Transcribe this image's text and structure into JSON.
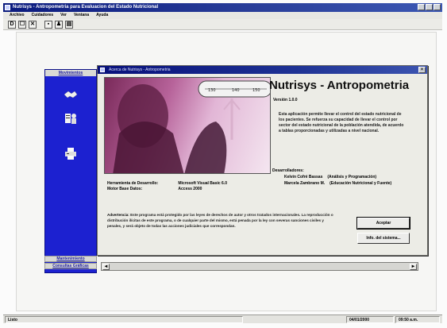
{
  "window": {
    "title": "Nutrisys - Antropometria para Evaluacion del Estado Nutricional"
  },
  "menu": [
    "Archivo",
    "Cuidadores",
    "Ver",
    "Ventana",
    "Ayuda"
  ],
  "toolbar": {
    "buttons": [
      {
        "icon": "new-document-icon",
        "glyph": "D"
      },
      {
        "icon": "open-icon",
        "glyph": "☐"
      },
      {
        "icon": "close-icon",
        "glyph": "✕"
      },
      {
        "icon": "save-icon",
        "glyph": "▪"
      },
      {
        "icon": "find-icon",
        "glyph": "♟"
      },
      {
        "icon": "exit-icon",
        "glyph": "▤"
      }
    ]
  },
  "sidebar": {
    "header": "Movimientos",
    "footer_items": [
      "Mantenimiento",
      "Consultas Gráficas"
    ]
  },
  "dialog": {
    "title": "Acerca de Nutrisys - Antropometria",
    "app_name": "Nutrisys - Antropometria",
    "version": "Versión 1.0.0",
    "description": "Esta aplicación permite llevar el control del estado nutricional de los pacientes. Se refuerza su capacidad de llevar el control por sector del estado nutricional de la población atendida, de acuerdo a tablas proporcionadas y utilizadas a nivel nacional.",
    "developers_label": "Desarrolladores:",
    "developers": [
      {
        "name": "Kelvin Cofré Bassas",
        "role": "(Análisis y Programación)"
      },
      {
        "name": "Marcela Zambrano M.",
        "role": "(Educación Nutricional y Fuente)"
      }
    ],
    "info": [
      {
        "label": "Herramienta de Desarrollo:",
        "value": "Microsoft Visual Basic 6.0"
      },
      {
        "label": "Motor Base Datos:",
        "value": "Access 2000"
      }
    ],
    "warning_prefix": "Advertencia:",
    "warning": "Este programa está protegido por las leyes de derechos de autor y otros tratados internacionales. La reproducción o distribución ilícitas de este programa, o de cualquier parte del mismo, está penada por la ley con severas sanciones civiles y penales, y será objeto de todas las acciones judiciales que correspondan.",
    "ok_button": "Aceptar",
    "sysinfo_button": "Info. del sistema...",
    "close_glyph": "✕"
  },
  "hscroll": {
    "left": "◄",
    "right": "►"
  },
  "statusbar": {
    "left": "Listo",
    "date": "04/01/2000",
    "time": "09:50 a.m."
  }
}
